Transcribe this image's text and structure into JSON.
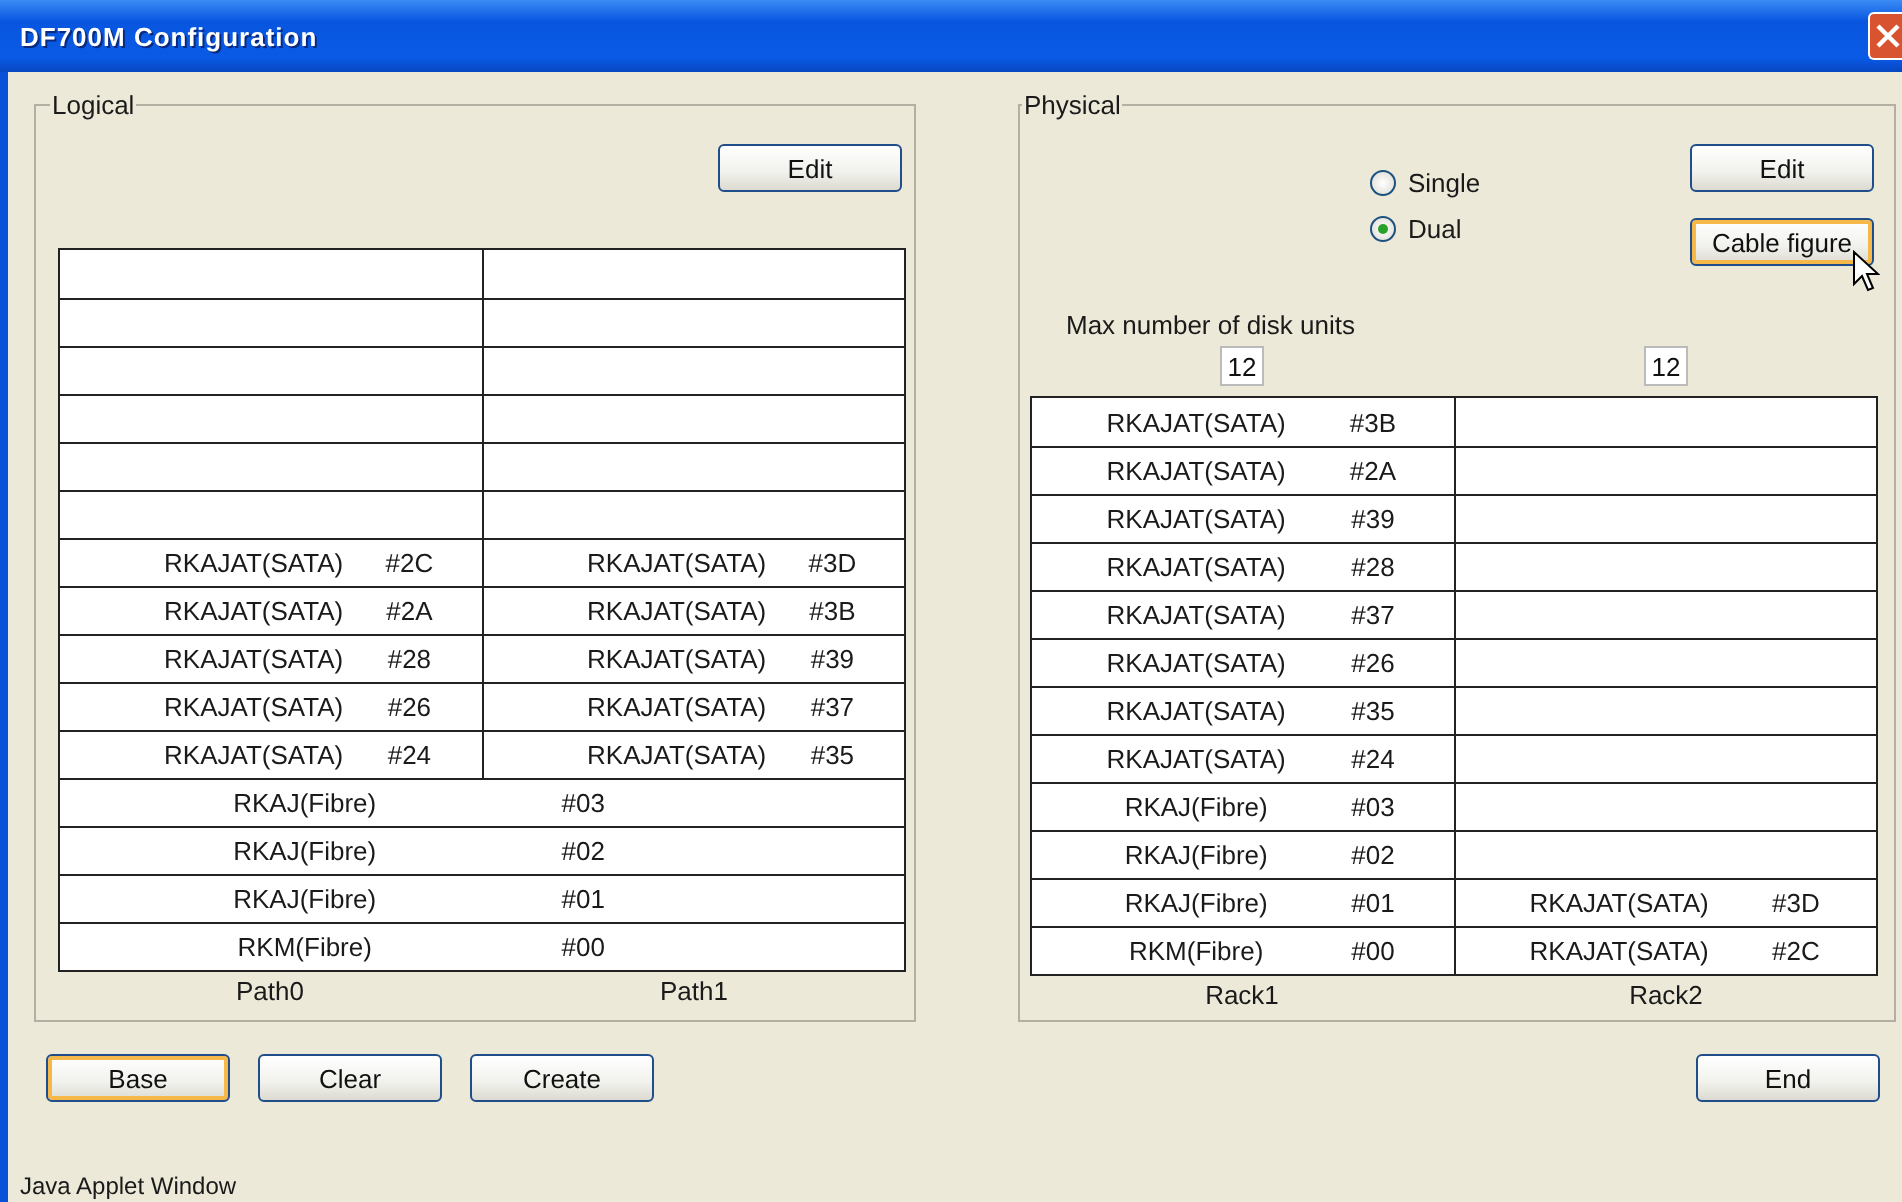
{
  "window": {
    "title": "DF700M Configuration"
  },
  "logical": {
    "title": "Logical",
    "edit_button": {
      "label": "Edit",
      "focused": false
    },
    "rows": [
      {
        "kind": "split",
        "cells": [
          {},
          {}
        ]
      },
      {
        "kind": "split",
        "cells": [
          {},
          {}
        ]
      },
      {
        "kind": "split",
        "cells": [
          {},
          {}
        ]
      },
      {
        "kind": "split",
        "cells": [
          {},
          {}
        ]
      },
      {
        "kind": "split",
        "cells": [
          {},
          {}
        ]
      },
      {
        "kind": "split",
        "cells": [
          {},
          {}
        ]
      },
      {
        "kind": "split",
        "cells": [
          {
            "name": "RKAJAT(SATA)",
            "code": "#2C"
          },
          {
            "name": "RKAJAT(SATA)",
            "code": "#3D"
          }
        ]
      },
      {
        "kind": "split",
        "cells": [
          {
            "name": "RKAJAT(SATA)",
            "code": "#2A"
          },
          {
            "name": "RKAJAT(SATA)",
            "code": "#3B"
          }
        ]
      },
      {
        "kind": "split",
        "cells": [
          {
            "name": "RKAJAT(SATA)",
            "code": "#28"
          },
          {
            "name": "RKAJAT(SATA)",
            "code": "#39"
          }
        ]
      },
      {
        "kind": "split",
        "cells": [
          {
            "name": "RKAJAT(SATA)",
            "code": "#26"
          },
          {
            "name": "RKAJAT(SATA)",
            "code": "#37"
          }
        ]
      },
      {
        "kind": "split",
        "cells": [
          {
            "name": "RKAJAT(SATA)",
            "code": "#24"
          },
          {
            "name": "RKAJAT(SATA)",
            "code": "#35"
          }
        ]
      },
      {
        "kind": "full",
        "name": "RKAJ(Fibre)",
        "code": "#03"
      },
      {
        "kind": "full",
        "name": "RKAJ(Fibre)",
        "code": "#02"
      },
      {
        "kind": "full",
        "name": "RKAJ(Fibre)",
        "code": "#01"
      },
      {
        "kind": "full",
        "name": "RKM(Fibre)",
        "code": "#00"
      }
    ],
    "column_labels": [
      "Path0",
      "Path1"
    ]
  },
  "physical": {
    "title": "Physical",
    "radios": [
      {
        "label": "Single",
        "selected": false
      },
      {
        "label": "Dual",
        "selected": true
      }
    ],
    "buttons": [
      {
        "label": "Edit",
        "focused": false
      },
      {
        "label": "Cable figure",
        "focused": true
      }
    ],
    "max_units_label": "Max number of disk units",
    "max_units": [
      "12",
      "12"
    ],
    "rows": [
      [
        {
          "name": "RKAJAT(SATA)",
          "code": "#3B"
        },
        {}
      ],
      [
        {
          "name": "RKAJAT(SATA)",
          "code": "#2A"
        },
        {}
      ],
      [
        {
          "name": "RKAJAT(SATA)",
          "code": "#39"
        },
        {}
      ],
      [
        {
          "name": "RKAJAT(SATA)",
          "code": "#28"
        },
        {}
      ],
      [
        {
          "name": "RKAJAT(SATA)",
          "code": "#37"
        },
        {}
      ],
      [
        {
          "name": "RKAJAT(SATA)",
          "code": "#26"
        },
        {}
      ],
      [
        {
          "name": "RKAJAT(SATA)",
          "code": "#35"
        },
        {}
      ],
      [
        {
          "name": "RKAJAT(SATA)",
          "code": "#24"
        },
        {}
      ],
      [
        {
          "name": "RKAJ(Fibre)",
          "code": "#03"
        },
        {}
      ],
      [
        {
          "name": "RKAJ(Fibre)",
          "code": "#02"
        },
        {}
      ],
      [
        {
          "name": "RKAJ(Fibre)",
          "code": "#01"
        },
        {
          "name": "RKAJAT(SATA)",
          "code": "#3D"
        }
      ],
      [
        {
          "name": "RKM(Fibre)",
          "code": "#00"
        },
        {
          "name": "RKAJAT(SATA)",
          "code": "#2C"
        }
      ]
    ],
    "column_labels": [
      "Rack1",
      "Rack2"
    ]
  },
  "bottom_buttons_left": [
    {
      "label": "Base",
      "focused": true
    },
    {
      "label": "Clear",
      "focused": false
    },
    {
      "label": "Create",
      "focused": false
    }
  ],
  "bottom_buttons_right": [
    {
      "label": "End",
      "focused": false
    }
  ],
  "status_bar": "Java Applet Window"
}
